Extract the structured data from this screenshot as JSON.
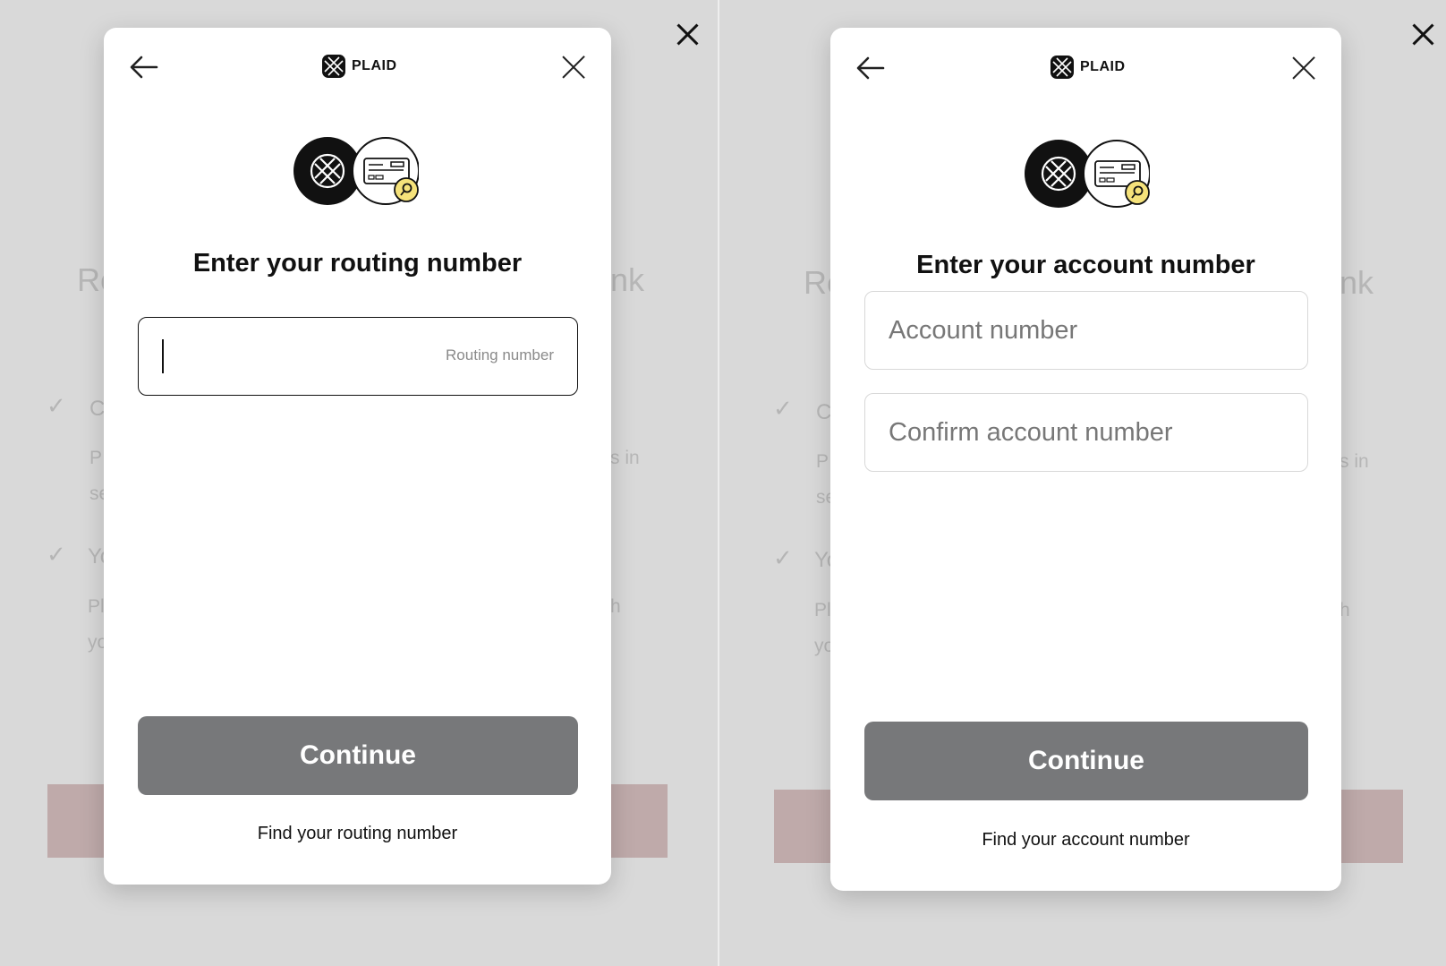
{
  "brand": {
    "name": "PLAID"
  },
  "background_page": {
    "title_start": "Re",
    "title_end": "nk",
    "items": [
      {
        "heading_start": "C",
        "body_start": "P",
        "body_end": "s in",
        "line2_start": "se"
      },
      {
        "heading_start": "Yo",
        "body_start": "Pl",
        "body_end": "h",
        "line2_start": "yo"
      }
    ]
  },
  "screens": [
    {
      "heading": "Enter your routing number",
      "fields": [
        {
          "placeholder": "Routing number",
          "value": ""
        }
      ],
      "continue_label": "Continue",
      "help_link": "Find your routing number"
    },
    {
      "heading": "Enter your account number",
      "fields": [
        {
          "placeholder": "Account number",
          "value": ""
        },
        {
          "placeholder": "Confirm account number",
          "value": ""
        }
      ],
      "continue_label": "Continue",
      "help_link": "Find your account number"
    }
  ],
  "colors": {
    "continue_button": "#77787a",
    "accent_yellow": "#f5e27a",
    "backdrop": "#d9d9d9",
    "background_bar": "#bfaaaa"
  },
  "icons": [
    "back-arrow-icon",
    "close-icon",
    "plaid-logo-icon",
    "check-icon",
    "magnifier-icon"
  ]
}
